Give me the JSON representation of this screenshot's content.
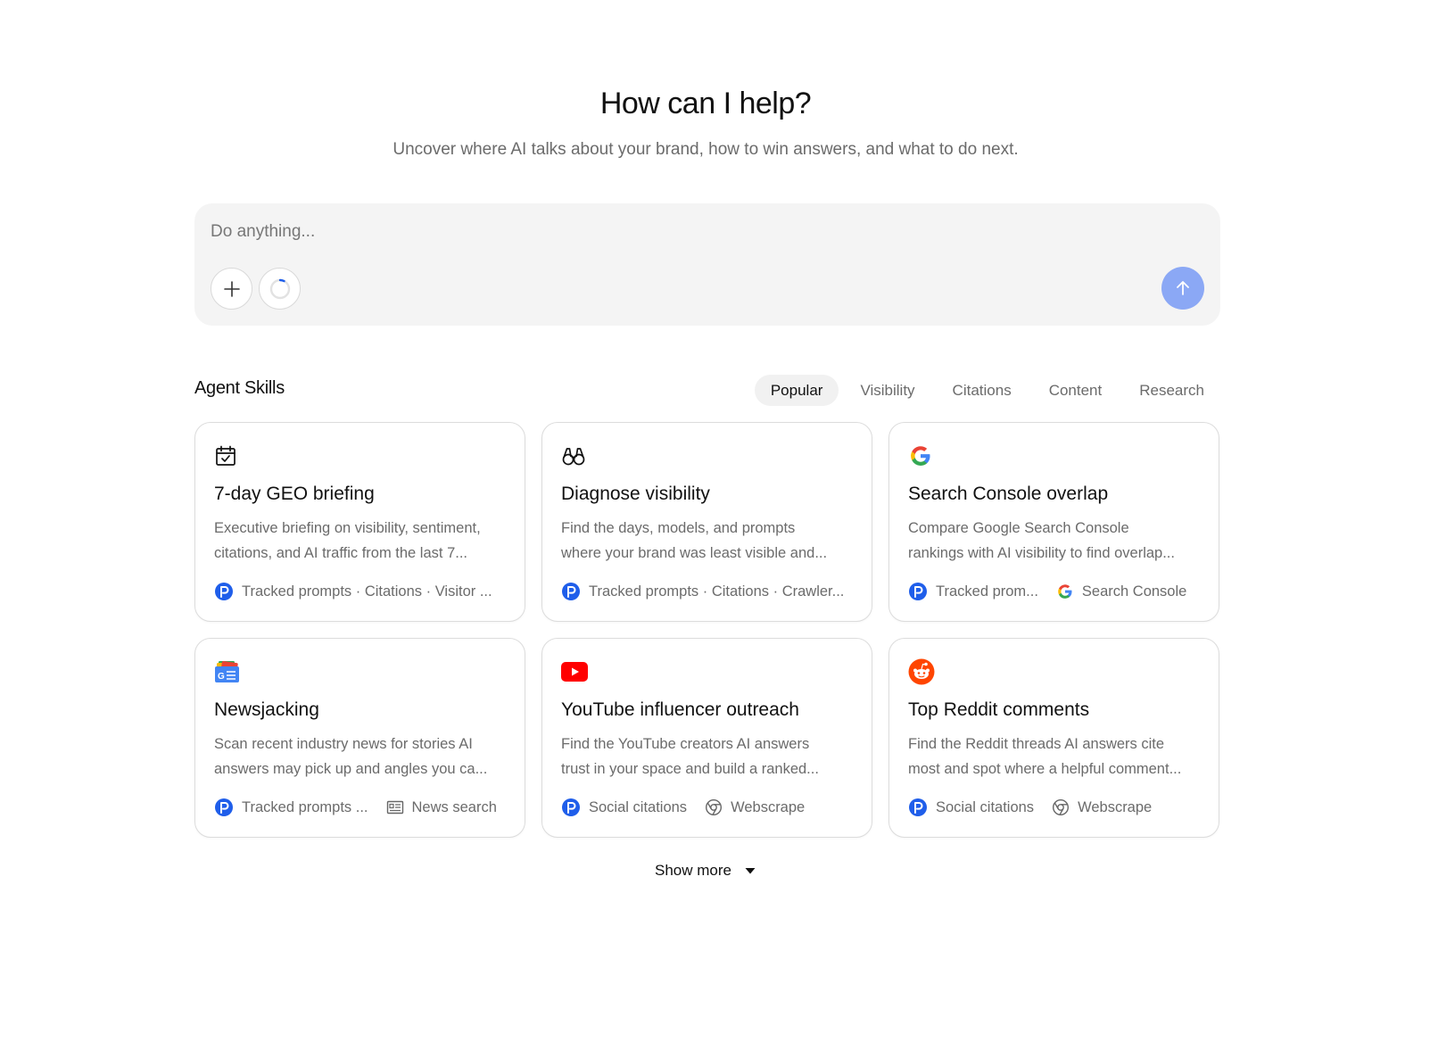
{
  "hero": {
    "title": "How can I help?",
    "subtitle": "Uncover where AI talks about your brand, how to win answers, and what to do next."
  },
  "composer": {
    "placeholder": "Do anything...",
    "value": ""
  },
  "skills": {
    "heading": "Agent Skills",
    "tabs": [
      {
        "label": "Popular",
        "active": true
      },
      {
        "label": "Visibility",
        "active": false
      },
      {
        "label": "Citations",
        "active": false
      },
      {
        "label": "Content",
        "active": false
      },
      {
        "label": "Research",
        "active": false
      }
    ],
    "cards": [
      {
        "icon": "calendar-check-icon",
        "title": "7-day GEO briefing",
        "desc_line1": "Executive briefing on visibility, sentiment,",
        "desc_line2": "citations, and AI traffic from the last 7...",
        "sources": [
          {
            "icon": "brand-p-icon",
            "label": "Tracked prompts · Citations · Visitor ..."
          }
        ]
      },
      {
        "icon": "binoculars-icon",
        "title": "Diagnose visibility",
        "desc_line1": "Find the days, models, and prompts",
        "desc_line2": "where your brand was least visible and...",
        "sources": [
          {
            "icon": "brand-p-icon",
            "label": "Tracked prompts · Citations · Crawler..."
          }
        ]
      },
      {
        "icon": "google-icon",
        "title": "Search Console overlap",
        "desc_line1": "Compare Google Search Console",
        "desc_line2": "rankings with AI visibility to find overlap...",
        "sources": [
          {
            "icon": "brand-p-icon",
            "label": "Tracked prom..."
          },
          {
            "icon": "google-icon",
            "label": "Search Console"
          }
        ]
      },
      {
        "icon": "google-news-icon",
        "title": "Newsjacking",
        "desc_line1": "Scan recent industry news for stories AI",
        "desc_line2": "answers may pick up and angles you ca...",
        "sources": [
          {
            "icon": "brand-p-icon",
            "label": "Tracked prompts ..."
          },
          {
            "icon": "newspaper-icon",
            "label": "News search"
          }
        ]
      },
      {
        "icon": "youtube-icon",
        "title": "YouTube influencer outreach",
        "desc_line1": "Find the YouTube creators AI answers",
        "desc_line2": "trust in your space and build a ranked...",
        "sources": [
          {
            "icon": "brand-p-icon",
            "label": "Social citations"
          },
          {
            "icon": "chrome-icon",
            "label": "Webscrape"
          }
        ]
      },
      {
        "icon": "reddit-icon",
        "title": "Top Reddit comments",
        "desc_line1": "Find the Reddit threads AI answers cite",
        "desc_line2": "most and spot where a helpful comment...",
        "sources": [
          {
            "icon": "brand-p-icon",
            "label": "Social citations"
          },
          {
            "icon": "chrome-icon",
            "label": "Webscrape"
          }
        ]
      }
    ],
    "show_more_label": "Show more"
  },
  "colors": {
    "accent": "#8ba8f5",
    "brand_blue": "#1f5eea",
    "text_muted": "#6b6b6b",
    "surface": "#f4f4f4"
  }
}
